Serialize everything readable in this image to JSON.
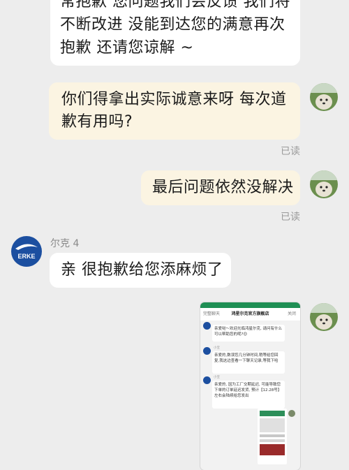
{
  "messages": {
    "m1": {
      "line1": "常抱歉  您问题我们会反馈 我们将",
      "line2": "不断改进 没能到达您的满意再次",
      "line3": "抱歉 还请您谅解 ~"
    },
    "m2": {
      "line1": "你们得拿出实际诚意来呀 每次道",
      "line2": "歉有用吗?"
    },
    "m3": {
      "text": "最后问题依然没解决"
    },
    "m4": {
      "text": "亲  很抱歉给您添麻烦了"
    },
    "read_label": "已读",
    "sender_name": "尔克 4",
    "erke_logo_text": "ERKE"
  },
  "embedded": {
    "back": "完整聊天",
    "title": "鸿星尔克官方旗舰店",
    "close": "关闭",
    "agent": "小宝",
    "b1": "亲爱哒～欢迎光临鸿星尔克, 请问有什么可以帮助您的呢?😊",
    "b2": "亲爱的,数误您几分钟时间,稍等给您回复,我这边查看一下聊天记录,等我下哈",
    "b3": "亲爱的, 因为工厂交期延迟, 可能导致您下单的订单延迟发货, 预计【12.28号】左右会陆续给您发出"
  },
  "colors": {
    "background": "#ededed",
    "self_bubble": "#fbf4e2",
    "other_bubble": "#ffffff",
    "brand_blue": "#1c4fa0"
  }
}
